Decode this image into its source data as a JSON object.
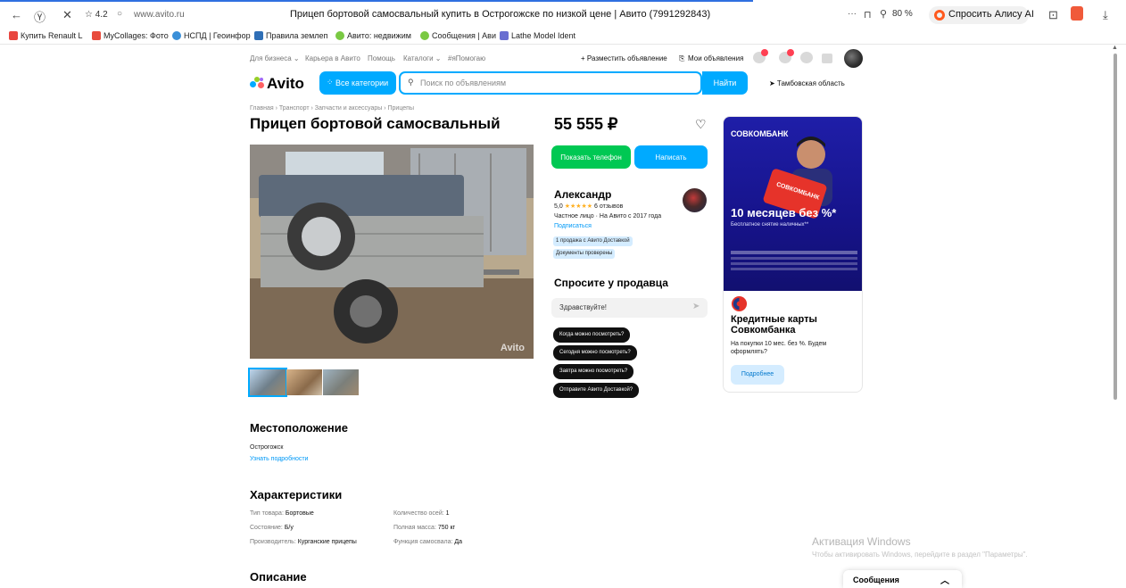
{
  "browser": {
    "rating": "☆ 4.2",
    "url": "www.avito.ru",
    "tab_title": "Прицеп бортовой самосвальный купить в Острогожске по низкой цене | Авито (7991292843)",
    "zoom": "80 %",
    "alice_label": "Спросить Алису AI",
    "bookmarks": [
      {
        "label": "Купить Renault L",
        "color": "#e8463f"
      },
      {
        "label": "MyCollages: Фото",
        "color": "#e84b3c"
      },
      {
        "label": "НСПД | Геоинфор",
        "color": "#3a8fd8"
      },
      {
        "label": "Правила землеп",
        "color": "#2f6fb6"
      },
      {
        "label": "Авито: недвижим",
        "color": "#7ac943"
      },
      {
        "label": "Сообщения | Ави",
        "color": "#7ac943"
      },
      {
        "label": "Lathe Model Ident",
        "color": "#6a6fd1"
      }
    ]
  },
  "topbar": {
    "links": [
      "Для бизнеса ⌄",
      "Карьера в Авито",
      "Помощь",
      "Каталоги ⌄",
      "#яПомогаю"
    ],
    "post_ad": "+ Разместить объявление",
    "my_ads": "Мои объявления",
    "badges": [
      "1",
      "2"
    ]
  },
  "header": {
    "logo": "Avito",
    "categories": "Все категории",
    "search_placeholder": "Поиск по объявлениям",
    "search_button": "Найти",
    "region": "➤ Тамбовская область"
  },
  "listing": {
    "breadcrumb": "Главная › Транспорт › Запчасти и аксессуары › Прицепы",
    "title": "Прицеп бортовой самосвальный",
    "price": "55 555 ₽",
    "photo_watermark": "Avito",
    "show_phone": "Показать телефон",
    "write": "Написать"
  },
  "seller": {
    "name": "Александр",
    "rating": "5,0",
    "stars": "★★★★★",
    "reviews": "6 отзывов",
    "type": "Частное лицо · На Авито с 2017 года",
    "subscribe": "Подписаться",
    "badges": [
      "1 продажа с Авито Доставкой",
      "Документы проверены"
    ]
  },
  "ask": {
    "title": "Спросите у продавца",
    "input_value": "Здравствуйте!",
    "questions": [
      "Когда можно посмотреть?",
      "Сегодня можно посмотреть?",
      "Завтра можно посмотреть?",
      "Отправите Авито Доставкой?"
    ]
  },
  "ad": {
    "brand": "СОВКОМБАНК",
    "card_text": "СОВКОМБАНК",
    "headline": "10 месяцев без %*",
    "sub": "Бесплатное снятие наличных**",
    "title": "Кредитные карты Совкомбанка",
    "text": "На покупки 10 мес. без %. Будем оформлять?",
    "button": "Подробнее"
  },
  "location": {
    "heading": "Местоположение",
    "city": "Острогожск",
    "more": "Узнать подробности"
  },
  "specs": {
    "heading": "Характеристики",
    "items": [
      {
        "label": "Тип товара:",
        "value": "Бортовые"
      },
      {
        "label": "Состояние:",
        "value": "Б/у"
      },
      {
        "label": "Производитель:",
        "value": "Курганские прицепы"
      },
      {
        "label": "Количество осей:",
        "value": "1"
      },
      {
        "label": "Полная масса:",
        "value": "750 кг"
      },
      {
        "label": "Функция самосвала:",
        "value": "Да"
      }
    ]
  },
  "description": {
    "heading": "Описание"
  },
  "windows": {
    "title": "Активация Windows",
    "text": "Чтобы активировать Windows, перейдите в раздел \"Параметры\"."
  },
  "messages": {
    "label": "Сообщения"
  }
}
